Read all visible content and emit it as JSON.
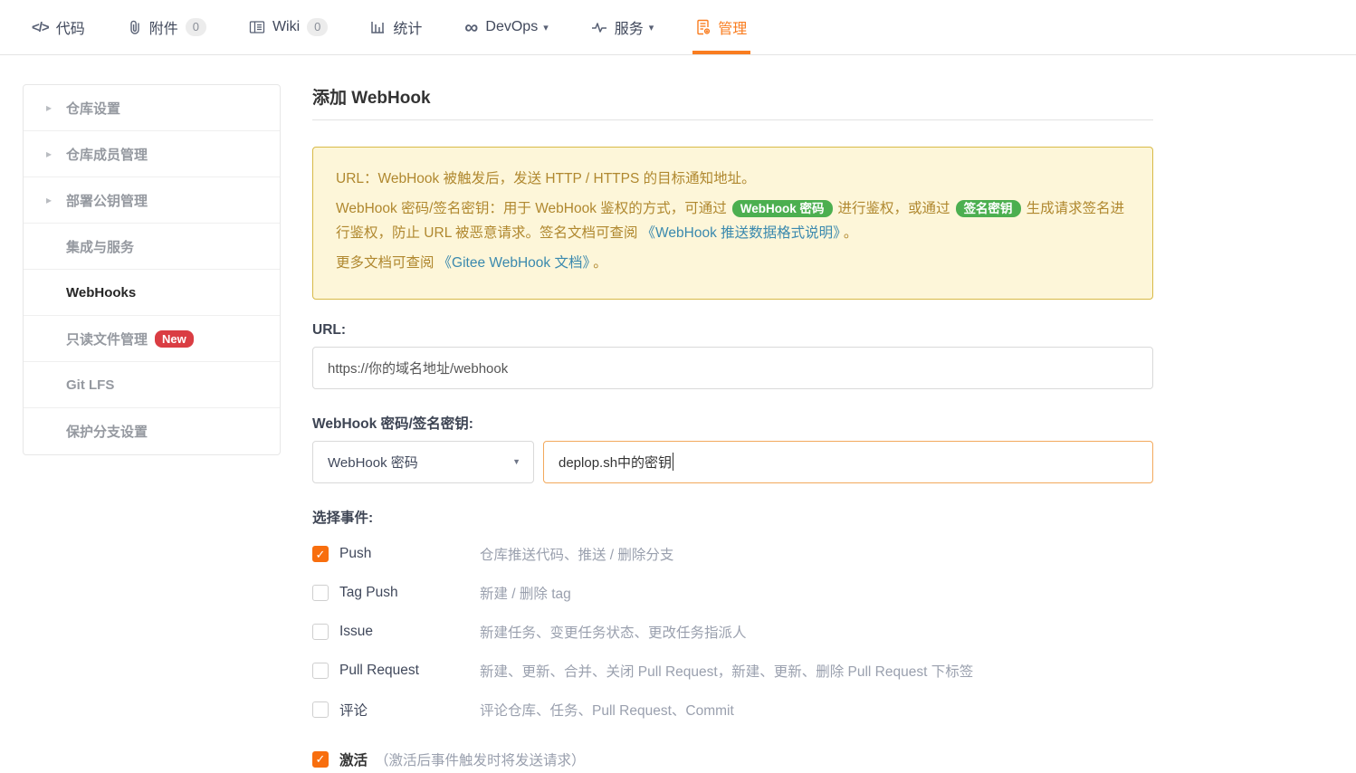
{
  "colors": {
    "accent_orange": "#f97d20",
    "checkbox_orange": "#f86e0e",
    "badge_green": "#4caf50",
    "badge_red": "#da3d43",
    "alert_bg": "#fdf6d9",
    "alert_border": "#d8ba47",
    "alert_text": "#b0882f",
    "link_blue": "#3a89ae"
  },
  "nav": {
    "items": [
      {
        "label": "代码",
        "icon": "code-icon"
      },
      {
        "label": "附件",
        "icon": "paperclip-icon",
        "badge": "0"
      },
      {
        "label": "Wiki",
        "icon": "book-icon",
        "badge": "0"
      },
      {
        "label": "统计",
        "icon": "bar-chart-icon"
      },
      {
        "label": "DevOps",
        "icon": "infinity-icon",
        "has_dropdown": true
      },
      {
        "label": "服务",
        "icon": "pulse-icon",
        "has_dropdown": true
      },
      {
        "label": "管理",
        "icon": "doc-gear-icon",
        "active": true
      }
    ]
  },
  "sidebar": {
    "items": [
      {
        "label": "仓库设置",
        "expandable": true
      },
      {
        "label": "仓库成员管理",
        "expandable": true
      },
      {
        "label": "部署公钥管理",
        "expandable": true
      },
      {
        "label": "集成与服务",
        "expandable": false
      },
      {
        "label": "WebHooks",
        "expandable": false,
        "active": true
      },
      {
        "label": "只读文件管理",
        "expandable": false,
        "badge": "New"
      },
      {
        "label": "Git LFS",
        "expandable": false
      },
      {
        "label": "保护分支设置",
        "expandable": false
      }
    ]
  },
  "main": {
    "title": "添加 WebHook",
    "alert": {
      "line1": "URL：WebHook 被触发后，发送 HTTP / HTTPS 的目标通知地址。",
      "line2_text1": "WebHook 密码/签名密钥：用于 WebHook 鉴权的方式，可通过",
      "line2_badge1": "WebHook 密码",
      "line2_text2": "进行鉴权，或通过",
      "line2_badge2": "签名密钥",
      "line2_text3": "生成请求签名进行鉴权，防止 URL 被恶意请求。签名文档可查阅",
      "line2_link": "《WebHook 推送数据格式说明》",
      "line2_text4": "。",
      "line3_text1": "更多文档可查阅",
      "line3_link": "《Gitee WebHook 文档》",
      "line3_text2": "。"
    },
    "form": {
      "url_label": "URL:",
      "url_value": "https://你的域名地址/webhook",
      "secret_label": "WebHook 密码/签名密钥:",
      "secret_type_selected": "WebHook 密码",
      "secret_value": "deplop.sh中的密钥",
      "events_label": "选择事件:",
      "events": [
        {
          "label": "Push",
          "checked": true,
          "desc": "仓库推送代码、推送 / 删除分支"
        },
        {
          "label": "Tag Push",
          "checked": false,
          "desc": "新建 / 删除 tag"
        },
        {
          "label": "Issue",
          "checked": false,
          "desc": "新建任务、变更任务状态、更改任务指派人"
        },
        {
          "label": "Pull Request",
          "checked": false,
          "desc": "新建、更新、合并、关闭 Pull Request，新建、更新、删除 Pull Request 下标签"
        },
        {
          "label": "评论",
          "checked": false,
          "desc": "评论仓库、任务、Pull Request、Commit"
        }
      ],
      "activate": {
        "label": "激活",
        "note": "（激活后事件触发时将发送请求）",
        "checked": true
      }
    }
  }
}
